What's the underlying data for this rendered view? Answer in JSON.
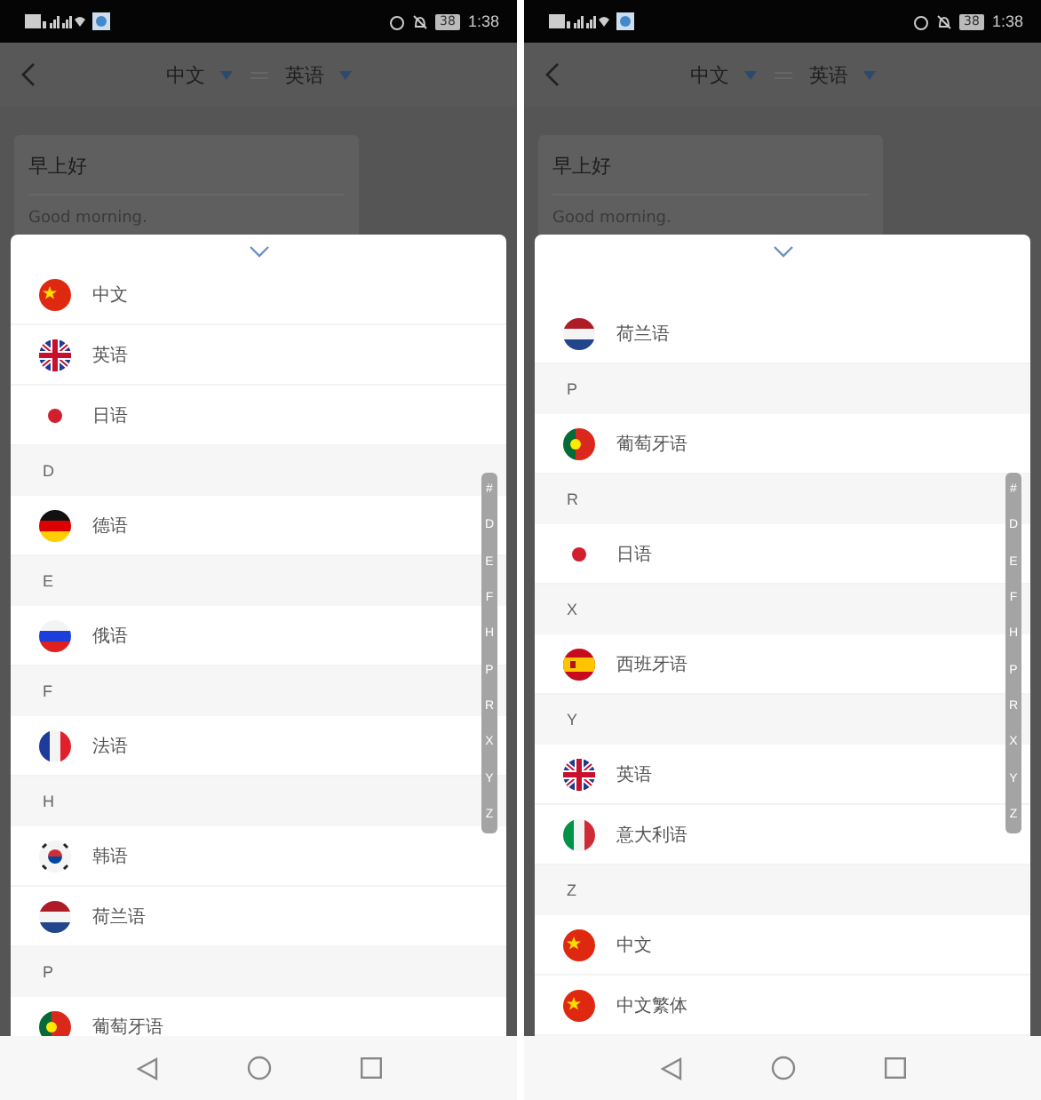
{
  "screens": [
    {
      "status_bar": {
        "time": "1:38",
        "battery": "38"
      },
      "header": {
        "source_language": "中文",
        "target_language": "英语"
      },
      "card": {
        "source_text": "早上好",
        "translation": "Good morning."
      },
      "list": [
        {
          "kind": "cn",
          "label": "中文"
        },
        {
          "kind": "gb",
          "label": "英语"
        },
        {
          "kind": "jp",
          "label": "日语"
        },
        {
          "kind": "section",
          "label": "D"
        },
        {
          "kind": "de",
          "label": "德语"
        },
        {
          "kind": "section",
          "label": "E"
        },
        {
          "kind": "ru",
          "label": "俄语"
        },
        {
          "kind": "section",
          "label": "F"
        },
        {
          "kind": "fr",
          "label": "法语"
        },
        {
          "kind": "section",
          "label": "H"
        },
        {
          "kind": "kr",
          "label": "韩语"
        },
        {
          "kind": "nl",
          "label": "荷兰语"
        },
        {
          "kind": "section",
          "label": "P"
        },
        {
          "kind": "pt",
          "label": "葡萄牙语"
        }
      ],
      "index": [
        "#",
        "D",
        "E",
        "F",
        "H",
        "P",
        "R",
        "X",
        "Y",
        "Z"
      ]
    },
    {
      "status_bar": {
        "time": "1:38",
        "battery": "38"
      },
      "header": {
        "source_language": "中文",
        "target_language": "英语"
      },
      "card": {
        "source_text": "早上好",
        "translation": "Good morning."
      },
      "list": [
        {
          "kind": "nl",
          "label": "荷兰语"
        },
        {
          "kind": "section",
          "label": "P"
        },
        {
          "kind": "pt",
          "label": "葡萄牙语"
        },
        {
          "kind": "section",
          "label": "R"
        },
        {
          "kind": "jp",
          "label": "日语"
        },
        {
          "kind": "section",
          "label": "X"
        },
        {
          "kind": "es",
          "label": "西班牙语"
        },
        {
          "kind": "section",
          "label": "Y"
        },
        {
          "kind": "gb",
          "label": "英语"
        },
        {
          "kind": "it",
          "label": "意大利语"
        },
        {
          "kind": "section",
          "label": "Z"
        },
        {
          "kind": "cn",
          "label": "中文"
        },
        {
          "kind": "cn",
          "label": "中文繁体"
        }
      ],
      "index": [
        "#",
        "D",
        "E",
        "F",
        "H",
        "P",
        "R",
        "X",
        "Y",
        "Z"
      ]
    }
  ]
}
